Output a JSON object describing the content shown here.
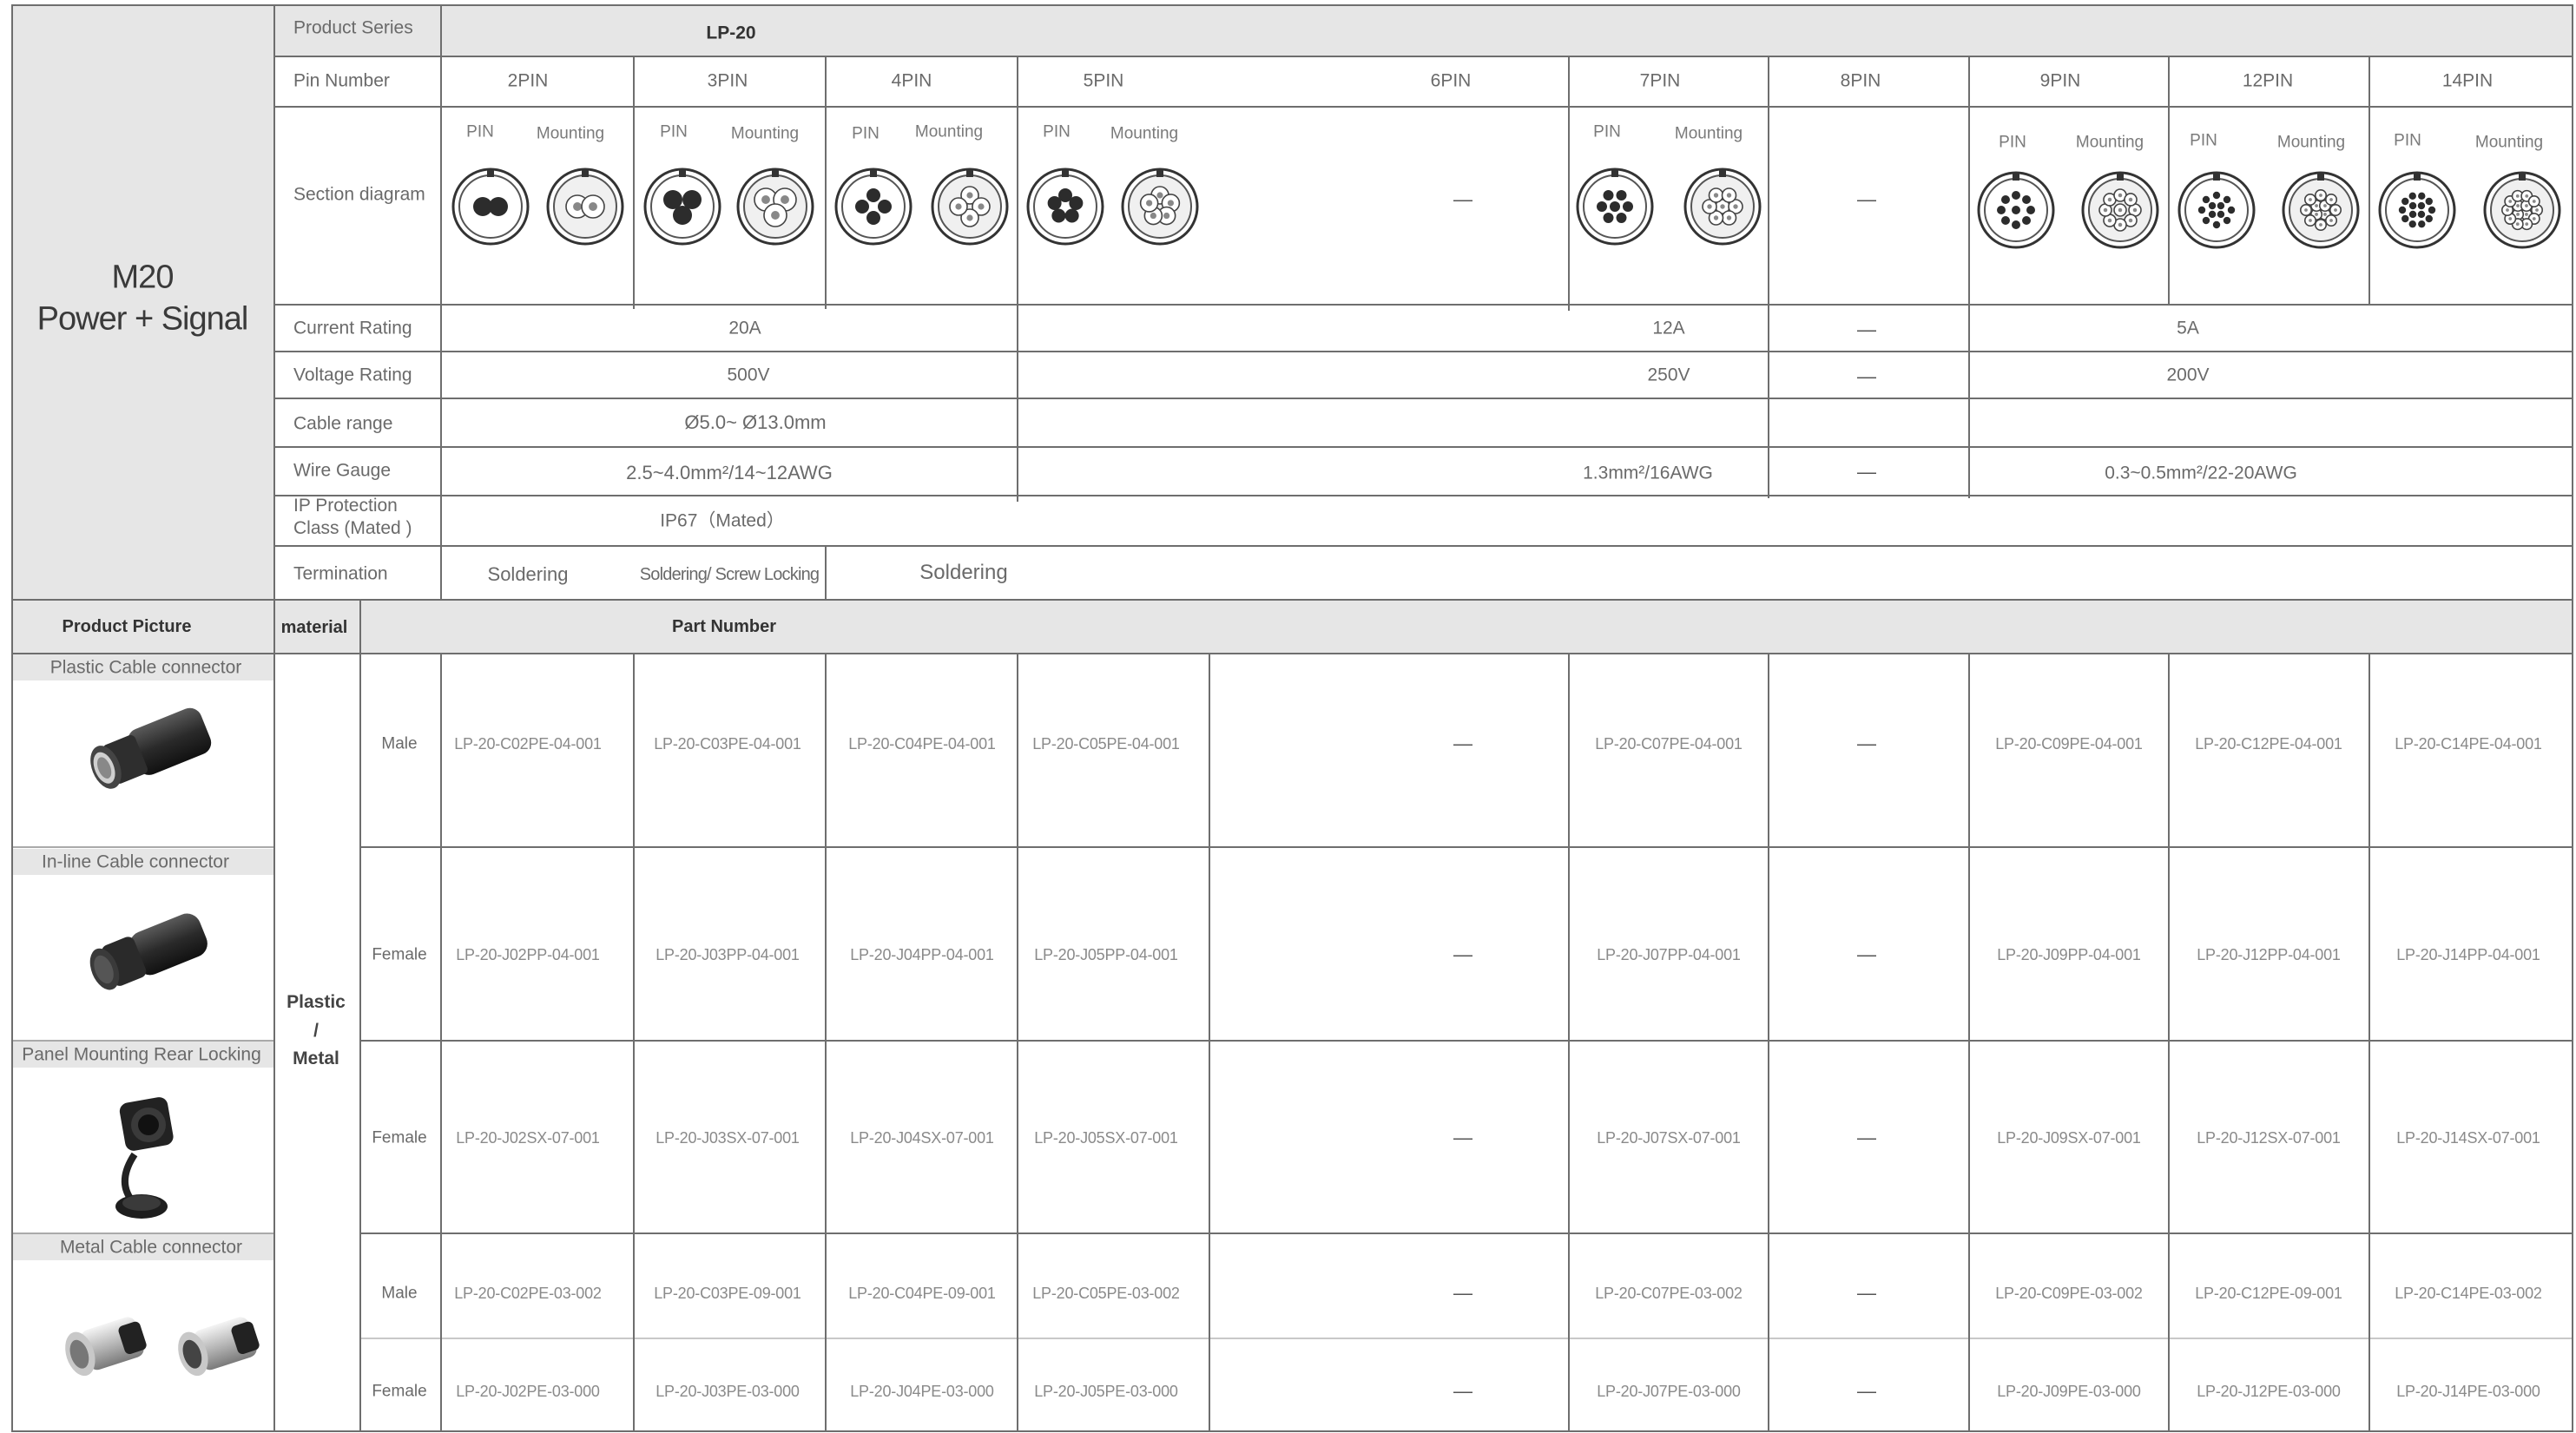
{
  "series_label": "Product Series",
  "series_value": "LP-20",
  "pin_number_label": "Pin Number",
  "pins": [
    "2PIN",
    "3PIN",
    "4PIN",
    "5PIN",
    "6PIN",
    "7PIN",
    "8PIN",
    "9PIN",
    "12PIN",
    "14PIN"
  ],
  "section_diagram_label": "Section diagram",
  "diagram_pin_label": "PIN",
  "diagram_mounting_label": "Mounting",
  "dash": "—",
  "product_title_line1": "M20",
  "product_title_line2": "Power + Signal",
  "current_rating": {
    "label": "Current Rating",
    "v1": "20A",
    "v2": "12A",
    "v3": "—",
    "v4": "5A"
  },
  "voltage_rating": {
    "label": "Voltage Rating",
    "v1": "500V",
    "v2": "250V",
    "v3": "—",
    "v4": "200V"
  },
  "cable_range": {
    "label": "Cable range",
    "value": "Ø5.0~ Ø13.0mm"
  },
  "wire_gauge": {
    "label": "Wire Gauge",
    "v1": "2.5~4.0mm²/14~12AWG",
    "v2": "1.3mm²/16AWG",
    "v3": "—",
    "v4": "0.3~0.5mm²/22-20AWG"
  },
  "ip_protection": {
    "label_line1": "IP Protection",
    "label_line2": "Class (Mated )",
    "value": "IP67（Mated）"
  },
  "termination": {
    "label": "Termination",
    "v1": "Soldering",
    "v2": "Soldering/ Screw Locking",
    "v3": "Soldering"
  },
  "product_picture_label": "Product Picture",
  "material_label": "material",
  "part_number_label": "Part Number",
  "material_value_line1": "Plastic",
  "material_value_line2": "/",
  "material_value_line3": "Metal",
  "products": [
    {
      "name": "Plastic Cable connector",
      "icon": "plastic-cable-connector-photo"
    },
    {
      "name": "In-line Cable connector",
      "icon": "inline-cable-connector-photo"
    },
    {
      "name": "Panel Mounting Rear Locking",
      "icon": "panel-mounting-connector-photo"
    },
    {
      "name": "Metal Cable connector",
      "icon": "metal-cable-connector-photo"
    }
  ],
  "part_rows": [
    {
      "gender": "Male",
      "parts": [
        "LP-20-C02PE-04-001",
        "LP-20-C03PE-04-001",
        "LP-20-C04PE-04-001",
        "LP-20-C05PE-04-001",
        "—",
        "LP-20-C07PE-04-001",
        "—",
        "LP-20-C09PE-04-001",
        "LP-20-C12PE-04-001",
        "LP-20-C14PE-04-001"
      ]
    },
    {
      "gender": "Female",
      "parts": [
        "LP-20-J02PP-04-001",
        "LP-20-J03PP-04-001",
        "LP-20-J04PP-04-001",
        "LP-20-J05PP-04-001",
        "—",
        "LP-20-J07PP-04-001",
        "—",
        "LP-20-J09PP-04-001",
        "LP-20-J12PP-04-001",
        "LP-20-J14PP-04-001"
      ]
    },
    {
      "gender": "Female",
      "parts": [
        "LP-20-J02SX-07-001",
        "LP-20-J03SX-07-001",
        "LP-20-J04SX-07-001",
        "LP-20-J05SX-07-001",
        "—",
        "LP-20-J07SX-07-001",
        "—",
        "LP-20-J09SX-07-001",
        "LP-20-J12SX-07-001",
        "LP-20-J14SX-07-001"
      ]
    },
    {
      "gender": "Male",
      "parts": [
        "LP-20-C02PE-03-002",
        "LP-20-C03PE-09-001",
        "LP-20-C04PE-09-001",
        "LP-20-C05PE-03-002",
        "—",
        "LP-20-C07PE-03-002",
        "—",
        "LP-20-C09PE-03-002",
        "LP-20-C12PE-09-001",
        "LP-20-C14PE-03-002"
      ]
    },
    {
      "gender": "Female",
      "parts": [
        "LP-20-J02PE-03-000",
        "LP-20-J03PE-03-000",
        "LP-20-J04PE-03-000",
        "LP-20-J05PE-03-000",
        "—",
        "LP-20-J07PE-03-000",
        "—",
        "LP-20-J09PE-03-000",
        "LP-20-J12PE-03-000",
        "LP-20-J14PE-03-000"
      ]
    }
  ]
}
